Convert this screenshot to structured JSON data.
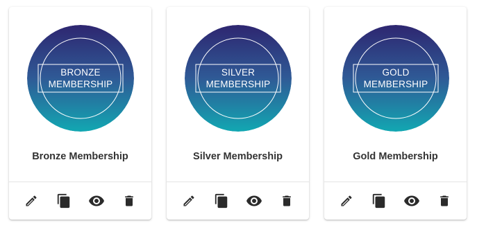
{
  "colors": {
    "badge_gradient_top": "#2e2670",
    "badge_gradient_mid": "#2f5a96",
    "badge_gradient_bottom": "#12a7b2",
    "icon": "#2b2b2b",
    "title": "#333333"
  },
  "cards": [
    {
      "badge_line1": "BRONZE",
      "badge_line2": "MEMBERSHIP",
      "title": "Bronze Membership",
      "actions": [
        "edit-icon",
        "copy-icon",
        "view-icon",
        "delete-icon"
      ]
    },
    {
      "badge_line1": "SILVER",
      "badge_line2": "MEMBERSHIP",
      "title": "Silver Membership",
      "actions": [
        "edit-icon",
        "copy-icon",
        "view-icon",
        "delete-icon"
      ]
    },
    {
      "badge_line1": "GOLD",
      "badge_line2": "MEMBERSHIP",
      "title": "Gold Membership",
      "actions": [
        "edit-icon",
        "copy-icon",
        "view-icon",
        "delete-icon"
      ]
    }
  ]
}
